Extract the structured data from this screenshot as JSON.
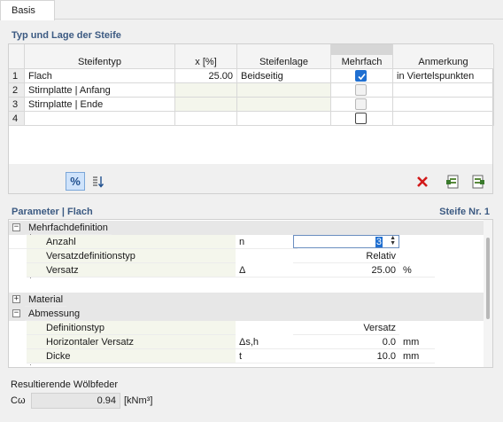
{
  "tab": {
    "label": "Basis"
  },
  "section1": {
    "title": "Typ und Lage der Steife"
  },
  "grid": {
    "headers": {
      "type": "Steifentyp",
      "x": "x [%]",
      "position": "Steifenlage",
      "multiple": "Mehrfach",
      "comment": "Anmerkung"
    },
    "rows": [
      {
        "num": "1",
        "type": "Flach",
        "x": "25.00",
        "position": "Beidseitig",
        "multiple": true,
        "comment": "in Viertelspunkten"
      },
      {
        "num": "2",
        "type": "Stirnplatte | Anfang",
        "x": "",
        "position": "",
        "multiple": false,
        "comment": ""
      },
      {
        "num": "3",
        "type": "Stirnplatte | Ende",
        "x": "",
        "position": "",
        "multiple": false,
        "comment": ""
      },
      {
        "num": "4",
        "type": "",
        "x": "",
        "position": "",
        "multiple": false,
        "comment": ""
      }
    ]
  },
  "toolbar": {
    "percent_icon": "percent-icon",
    "sort_icon": "sort-icon",
    "delete_icon": "delete-icon",
    "import_icon": "import-icon",
    "export_icon": "export-icon",
    "percent_label": "%"
  },
  "section2": {
    "title": "Parameter | Flach",
    "right": "Steife Nr. 1"
  },
  "params": {
    "groups": {
      "multiple": "Mehrfachdefinition",
      "material": "Material",
      "dimension": "Abmessung"
    },
    "rows": {
      "count": {
        "label": "Anzahl",
        "symbol": "n",
        "value": "3"
      },
      "offset_type": {
        "label": "Versatzdefinitionstyp",
        "value": "Relativ"
      },
      "offset": {
        "label": "Versatz",
        "symbol": "Δ",
        "value": "25.00",
        "unit": "%"
      },
      "def_type": {
        "label": "Definitionstyp",
        "value": "Versatz"
      },
      "h_offset": {
        "label": "Horizontaler Versatz",
        "symbol": "Δs,h",
        "value": "0.0",
        "unit": "mm"
      },
      "thickness": {
        "label": "Dicke",
        "symbol": "t",
        "value": "10.0",
        "unit": "mm"
      }
    }
  },
  "result": {
    "label": "Resultierende Wölbfeder",
    "symbol": "Cω",
    "value": "0.94",
    "unit": "[kNm³]"
  }
}
